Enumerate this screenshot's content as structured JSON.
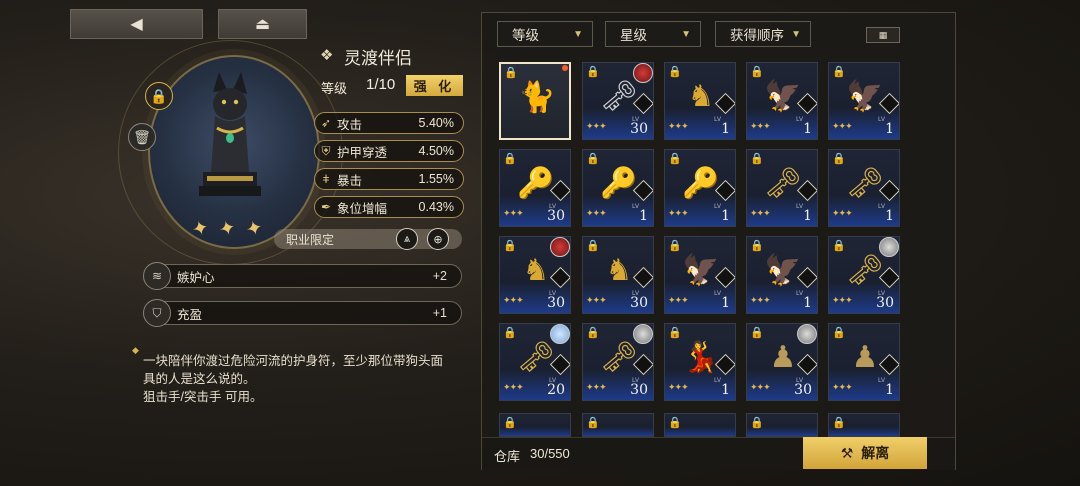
{
  "top": {
    "back_icon": "◀",
    "home_icon": "⏏"
  },
  "item": {
    "title": "灵渡伴侣",
    "level_label": "等级",
    "level_value": "1/10",
    "enhance_label": "强 化",
    "stats": [
      {
        "name": "攻击",
        "value": "5.40%",
        "icon": "sword-arrow-icon"
      },
      {
        "name": "护甲穿透",
        "value": "4.50%",
        "icon": "armor-pierce-icon"
      },
      {
        "name": "暴击",
        "value": "1.55%",
        "icon": "crit-icon"
      },
      {
        "name": "象位增幅",
        "value": "0.43%",
        "icon": "quill-icon"
      }
    ],
    "class_limit_label": "职业限定",
    "traits": [
      {
        "name": "嫉妒心",
        "value": "+2"
      },
      {
        "name": "充盈",
        "value": "+1"
      }
    ],
    "description_lines": [
      "一块陪伴你渡过危险河流的护身符，至少那位带狗头面",
      "具的人是这么说的。",
      "狙击手/突击手 可用。"
    ]
  },
  "filters": {
    "level": "等级",
    "stars": "星级",
    "order": "获得顺序"
  },
  "inventory": {
    "slots": [
      {
        "level": "",
        "art": "cat",
        "badge": "",
        "selected": true,
        "newdot": true
      },
      {
        "level": "30",
        "art": "key-silver",
        "badge": "red"
      },
      {
        "level": "1",
        "art": "gold-bust",
        "badge": ""
      },
      {
        "level": "1",
        "art": "wings",
        "badge": ""
      },
      {
        "level": "1",
        "art": "wings",
        "badge": ""
      },
      {
        "level": "30",
        "art": "keys",
        "badge": ""
      },
      {
        "level": "1",
        "art": "keys",
        "badge": ""
      },
      {
        "level": "1",
        "art": "keys",
        "badge": ""
      },
      {
        "level": "1",
        "art": "key-gold",
        "badge": ""
      },
      {
        "level": "1",
        "art": "key-gold",
        "badge": ""
      },
      {
        "level": "30",
        "art": "gold-bust",
        "badge": "red"
      },
      {
        "level": "30",
        "art": "gold-bust",
        "badge": ""
      },
      {
        "level": "1",
        "art": "wings",
        "badge": ""
      },
      {
        "level": "1",
        "art": "wings",
        "badge": ""
      },
      {
        "level": "30",
        "art": "key-red",
        "badge": "gray"
      },
      {
        "level": "20",
        "art": "key-blue",
        "badge": "blue"
      },
      {
        "level": "30",
        "art": "key-red",
        "badge": "gray"
      },
      {
        "level": "1",
        "art": "dancer",
        "badge": ""
      },
      {
        "level": "30",
        "art": "soldier",
        "badge": "gray"
      },
      {
        "level": "1",
        "art": "soldier",
        "badge": ""
      }
    ],
    "storage_label": "仓库",
    "storage_count": "30/550",
    "dismantle_label": "解离"
  }
}
